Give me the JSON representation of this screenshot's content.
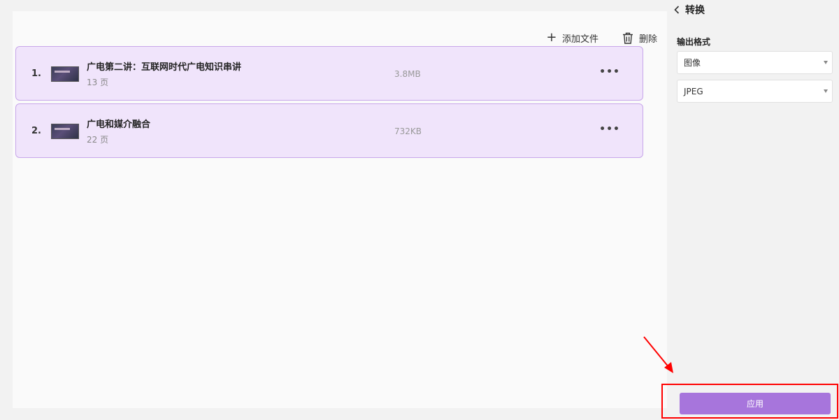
{
  "toolbar": {
    "add_file_label": "添加文件",
    "delete_label": "删除"
  },
  "files": [
    {
      "index": "1.",
      "name": "广电第二讲：互联网时代广电知识串讲",
      "pages": "13 页",
      "size": "3.8MB"
    },
    {
      "index": "2.",
      "name": "广电和媒介融合",
      "pages": "22 页",
      "size": "732KB"
    }
  ],
  "panel": {
    "title": "转换",
    "output_format_label": "输出格式",
    "format_select": "图像",
    "image_type_select": "JPEG",
    "apply_label": "应用"
  },
  "colors": {
    "accent": "#a775dc",
    "item_bg": "#f0e4fb",
    "item_border": "#c8a7ea",
    "highlight": "#ff0000"
  }
}
